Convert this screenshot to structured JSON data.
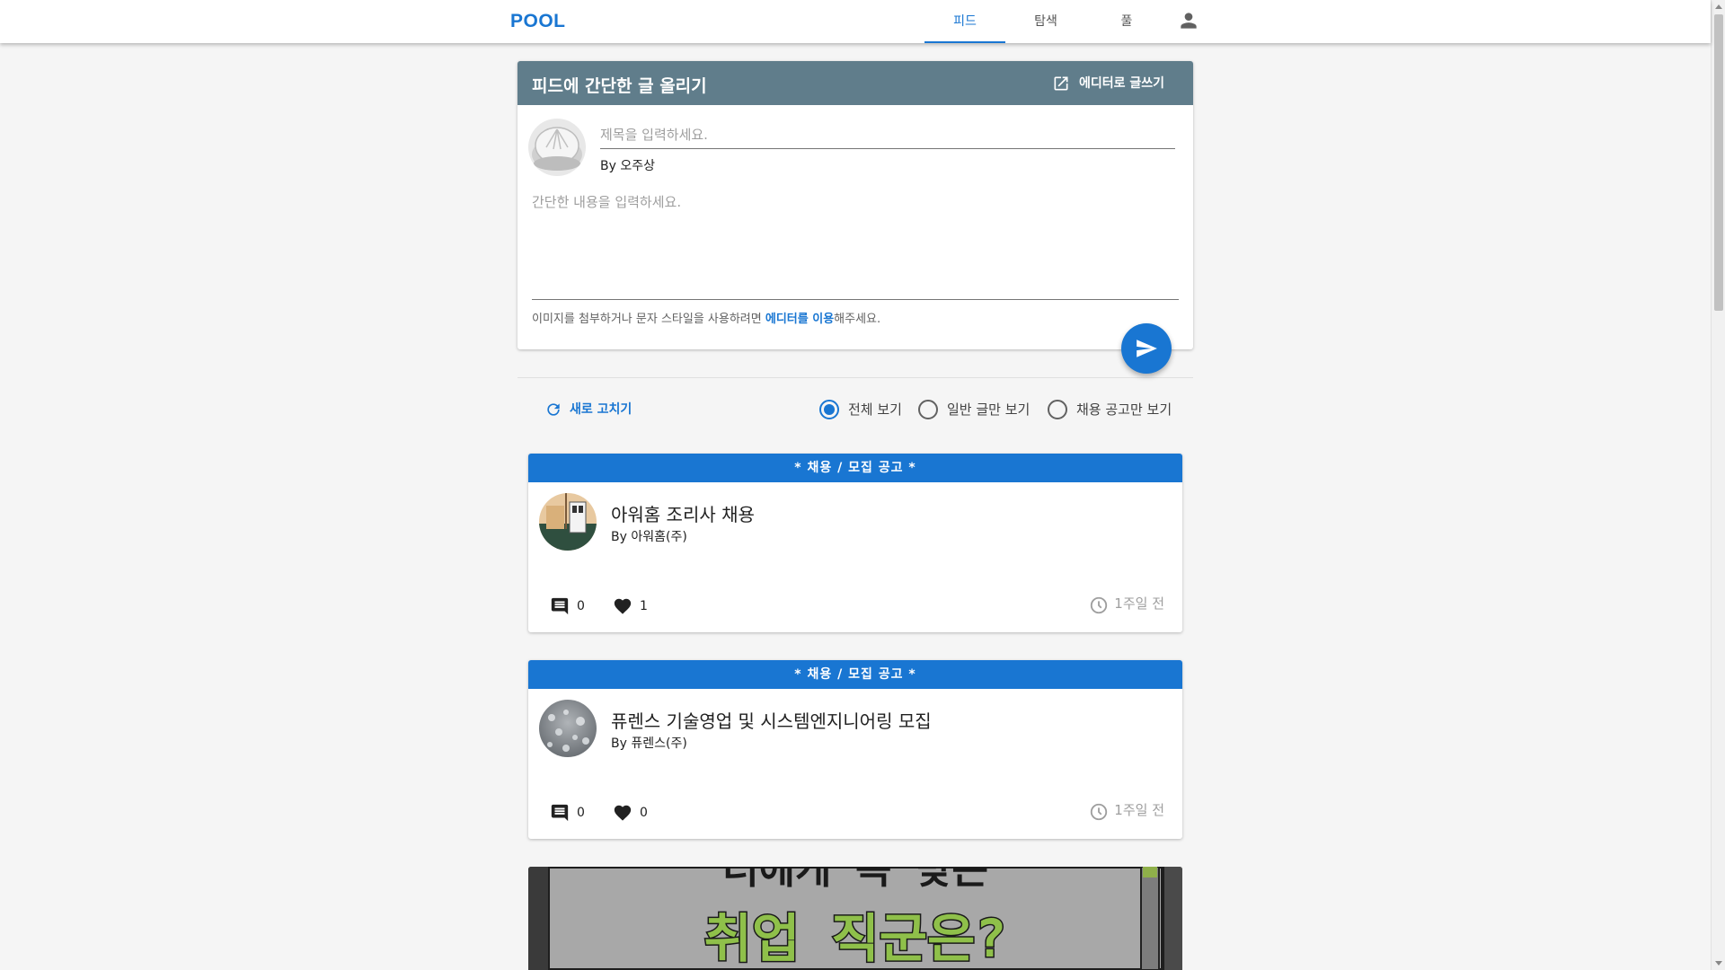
{
  "nav": {
    "logo": "POOL",
    "tabs": [
      {
        "label": "피드",
        "active": true
      },
      {
        "label": "탐색",
        "active": false
      },
      {
        "label": "풀",
        "active": false
      }
    ],
    "user_icon": "account-icon"
  },
  "compose": {
    "header_title": "피드에 간단한 글 올리기",
    "editor_button_label": "에디터로 글쓰기",
    "title_placeholder": "제목을 입력하세요.",
    "author_label": "By 오주상",
    "body_placeholder": "간단한 내용을 입력하세요.",
    "hint_prefix": "이미지를 첨부하거나 문자 스타일을 사용하려면 ",
    "hint_link": "에디터를 이용",
    "hint_suffix": "해주세요."
  },
  "filters": {
    "refresh_label": "새로 고치기",
    "options": [
      {
        "label": "전체 보기",
        "checked": true
      },
      {
        "label": "일반 글만 보기",
        "checked": false
      },
      {
        "label": "채용 공고만 보기",
        "checked": false
      }
    ]
  },
  "posts": [
    {
      "banner": "* 채용 / 모집 공고 *",
      "title": "아워홈 조리사 채용",
      "author": "By 아워홈(주)",
      "comments": "0",
      "likes": "1",
      "time": "1주일 전"
    },
    {
      "banner": "* 채용 / 모집 공고 *",
      "title": "퓨렌스 기술영업 및 시스템엔지니어링 모집",
      "author": "By 퓨렌스(주)",
      "comments": "0",
      "likes": "0",
      "time": "1주일 전"
    }
  ],
  "image_post": {
    "image_text_line1": "너에게 꼭 맞는",
    "image_text_line2": "취업 직군은?"
  },
  "colors": {
    "primary": "#1976d2",
    "compose_header": "#607d8b",
    "background": "#f5f5f5"
  }
}
